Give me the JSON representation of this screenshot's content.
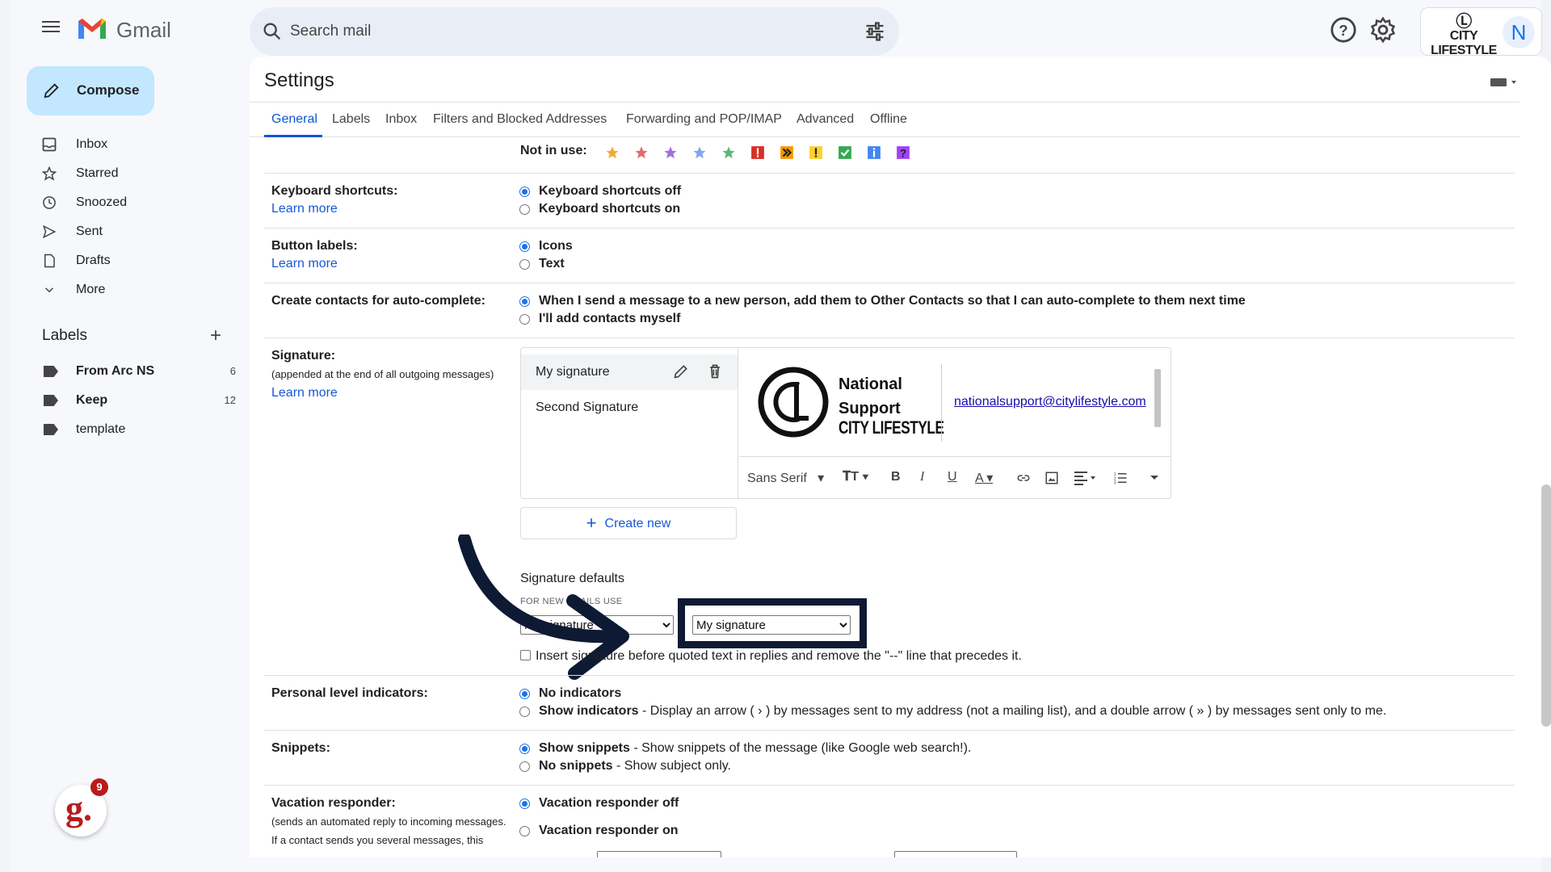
{
  "app": {
    "brand": "Gmail"
  },
  "search": {
    "placeholder": "Search mail"
  },
  "account": {
    "org_logo_text": "CITY LIFESTYLE",
    "avatar_letter": "N"
  },
  "sidebar": {
    "compose": "Compose",
    "items": [
      {
        "label": "Inbox",
        "icon": "inbox-icon"
      },
      {
        "label": "Starred",
        "icon": "star-icon"
      },
      {
        "label": "Snoozed",
        "icon": "clock-icon"
      },
      {
        "label": "Sent",
        "icon": "send-icon"
      },
      {
        "label": "Drafts",
        "icon": "draft-icon"
      },
      {
        "label": "More",
        "icon": "chevron-down-icon"
      }
    ],
    "labels_heading": "Labels",
    "labels": [
      {
        "name": "From Arc NS",
        "count": "6",
        "bold": true
      },
      {
        "name": "Keep",
        "count": "12",
        "bold": true
      },
      {
        "name": "template",
        "count": "",
        "bold": false
      }
    ],
    "extension_badge_count": "9"
  },
  "settings": {
    "title": "Settings",
    "tabs": [
      "General",
      "Labels",
      "Inbox",
      "Filters and Blocked Addresses",
      "Forwarding and POP/IMAP",
      "Advanced",
      "Offline"
    ],
    "active_tab": "General",
    "stars": {
      "not_in_use_label": "Not in use:"
    },
    "keyboard": {
      "label": "Keyboard shortcuts:",
      "learn_more": "Learn more",
      "options": [
        "Keyboard shortcuts off",
        "Keyboard shortcuts on"
      ],
      "selected": 0
    },
    "button_labels": {
      "label": "Button labels:",
      "learn_more": "Learn more",
      "options": [
        "Icons",
        "Text"
      ],
      "selected": 0
    },
    "contacts": {
      "label": "Create contacts for auto-complete:",
      "options": [
        "When I send a message to a new person, add them to Other Contacts so that I can auto-complete to them next time",
        "I'll add contacts myself"
      ],
      "selected": 0
    },
    "signature": {
      "label": "Signature:",
      "sub": "(appended at the end of all outgoing messages)",
      "learn_more": "Learn more",
      "list": [
        "My signature",
        "Second Signature"
      ],
      "selected": "My signature",
      "preview": {
        "name_line1": "National",
        "name_line2": "Support",
        "org": "CITY LIFESTYLE",
        "email": "nationalsupport@citylifestyle.com"
      },
      "toolbar": {
        "font": "Sans Serif"
      },
      "create_new": "Create new",
      "defaults_title": "Signature defaults",
      "for_new_label": "FOR NEW EMAILS USE",
      "for_new_value": "My signature",
      "on_reply_value": "My signature",
      "insert_before_text": "Insert signature before quoted text in replies and remove the \"--\" line that precedes it."
    },
    "personal_indicators": {
      "label": "Personal level indicators:",
      "opt1_bold": "No indicators",
      "opt2_bold": "Show indicators",
      "opt2_rest": " - Display an arrow ( › ) by messages sent to my address (not a mailing list), and a double arrow ( » ) by messages sent only to me.",
      "selected": 0
    },
    "snippets": {
      "label": "Snippets:",
      "opt1_bold": "Show snippets",
      "opt1_rest": " - Show snippets of the message (like Google web search!).",
      "opt2_bold": "No snippets",
      "opt2_rest": " - Show subject only.",
      "selected": 0
    },
    "vacation": {
      "label": "Vacation responder:",
      "sub1": "(sends an automated reply to incoming messages.",
      "sub2": "If a contact sends you several messages, this",
      "options": [
        "Vacation responder off",
        "Vacation responder on"
      ],
      "selected": 0
    }
  },
  "colors": {
    "accent": "#0b57d0",
    "compose_bg": "#c2e7ff",
    "annotation": "#0e1a33"
  }
}
